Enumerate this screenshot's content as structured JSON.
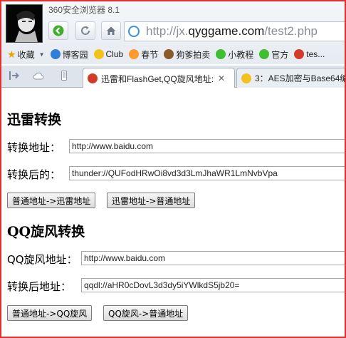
{
  "window": {
    "title": "360安全浏览器 8.1",
    "url_prefix": "http://jx.",
    "url_host": "qyggame.com",
    "url_path": "/test2.php"
  },
  "bookmarks": [
    {
      "label": "收藏",
      "icon": "star-icon",
      "color": "#f0a000"
    },
    {
      "label": "博客园",
      "icon": "cnblogs-icon",
      "color": "#2f7fd8"
    },
    {
      "label": "Club",
      "icon": "club-icon",
      "color": "#f2c21a"
    },
    {
      "label": "春节",
      "icon": "festival-icon",
      "color": "#ff9a2e"
    },
    {
      "label": "狗爹拍卖",
      "icon": "dog-icon",
      "color": "#8a5a2a"
    },
    {
      "label": "小教程",
      "icon": "wechat-icon",
      "color": "#3fbf2f"
    },
    {
      "label": "官方",
      "icon": "wechat-icon",
      "color": "#3fbf2f"
    },
    {
      "label": "tes...",
      "icon": "site-icon",
      "color": "#d23a2a"
    }
  ],
  "tabs": [
    {
      "label": "迅雷和FlashGet,QQ旋风地址:",
      "close": "✕",
      "active": true
    },
    {
      "label": "3：AES加密与Base64编",
      "active": false
    }
  ],
  "thunder": {
    "heading": "迅雷转换",
    "address_label": "转换地址：",
    "address_value": "http://www.baidu.com",
    "result_label": "转换后的：",
    "result_value": "thunder://QUFodHRwOi8vd3d3LmJhaWR1LmNvbVpa",
    "to_thunder_button": "普通地址->迅雷地址",
    "to_normal_button": "迅雷地址->普通地址"
  },
  "qq": {
    "heading": "QQ旋风转换",
    "address_label": "QQ旋风地址：",
    "address_value": "http://www.baidu.com",
    "result_label": "转换后地址：",
    "result_value": "qqdl://aHR0cDovL3d3dy5iYWlkdS5jb20=",
    "to_qq_button": "普通地址->QQ旋风",
    "to_normal_button": "QQ旋风->普通地址"
  }
}
